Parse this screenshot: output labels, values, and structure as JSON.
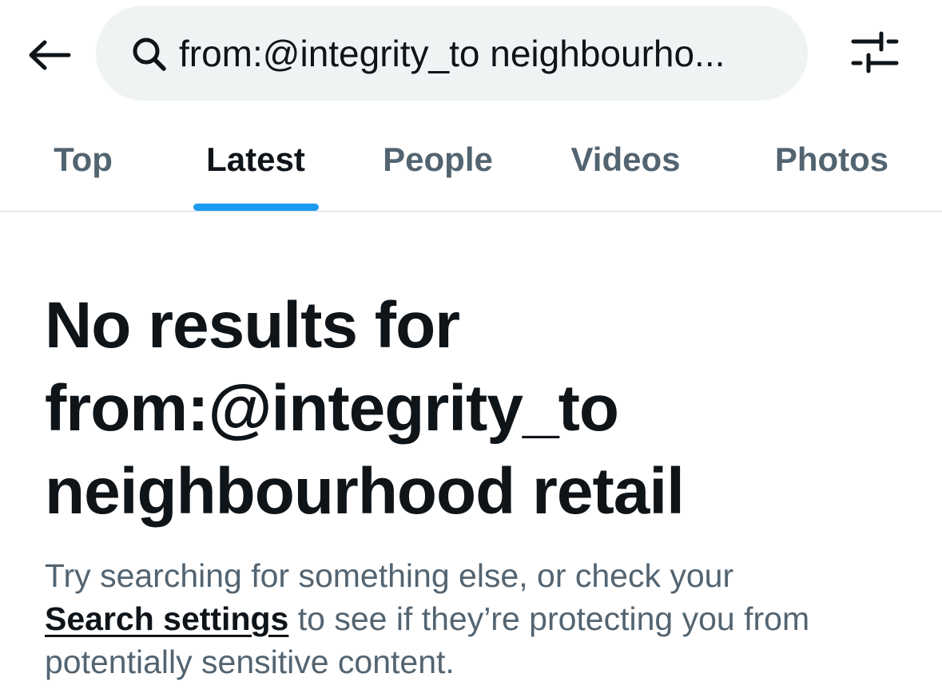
{
  "header": {
    "back_icon": "back-arrow-icon",
    "search": {
      "icon": "search-icon",
      "value": "from:@integrity_to neighbourhood retail",
      "display_value": "from:@integrity_to neighbourho..."
    },
    "filter_icon": "search-filter-sliders-icon"
  },
  "tabs": [
    {
      "label": "Top",
      "active": false
    },
    {
      "label": "Latest",
      "active": true
    },
    {
      "label": "People",
      "active": false
    },
    {
      "label": "Videos",
      "active": false
    },
    {
      "label": "Photos",
      "active": false
    }
  ],
  "empty_state": {
    "title_line1": "No results for",
    "title_line2": "from:@integrity_to",
    "title_line3": "neighbourhood retail",
    "body_before_link": "Try searching for something else, or check your",
    "link_text": "Search settings",
    "body_after_link": " to see if they’re protecting you from potentially sensitive content."
  },
  "colors": {
    "accent": "#1d9bf0",
    "text_primary": "#0f1419",
    "text_secondary": "#536471",
    "search_bg": "#eff3f4",
    "divider": "#cfd9de"
  }
}
